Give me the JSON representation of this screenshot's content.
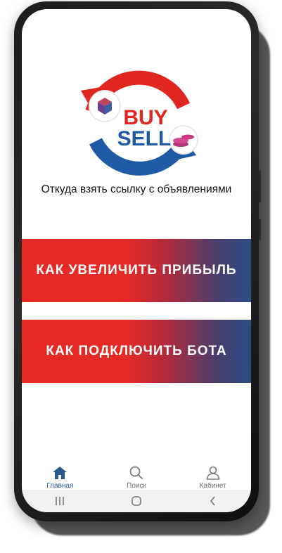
{
  "logo": {
    "buy": "BUY",
    "sell": "SELL",
    "colors": {
      "red": "#e1251f",
      "blue": "#1f5aa6"
    }
  },
  "caption": "Откуда взять ссылку с объявлениями",
  "banners": [
    {
      "label": "КАК УВЕЛИЧИТЬ ПРИБЫЛЬ"
    },
    {
      "label": "КАК ПОДКЛЮЧИТЬ БОТА"
    }
  ],
  "nav": {
    "items": [
      {
        "label": "Главная",
        "icon": "home-icon",
        "active": true
      },
      {
        "label": "Поиск",
        "icon": "search-icon",
        "active": false
      },
      {
        "label": "Кабинет",
        "icon": "user-icon",
        "active": false
      }
    ]
  },
  "system_nav": [
    "recent-apps-icon",
    "home-circle-icon",
    "back-icon"
  ],
  "colors": {
    "accent": "#2b5b8e",
    "banner_red": "#e52a26",
    "banner_blue": "#2c4c86"
  }
}
